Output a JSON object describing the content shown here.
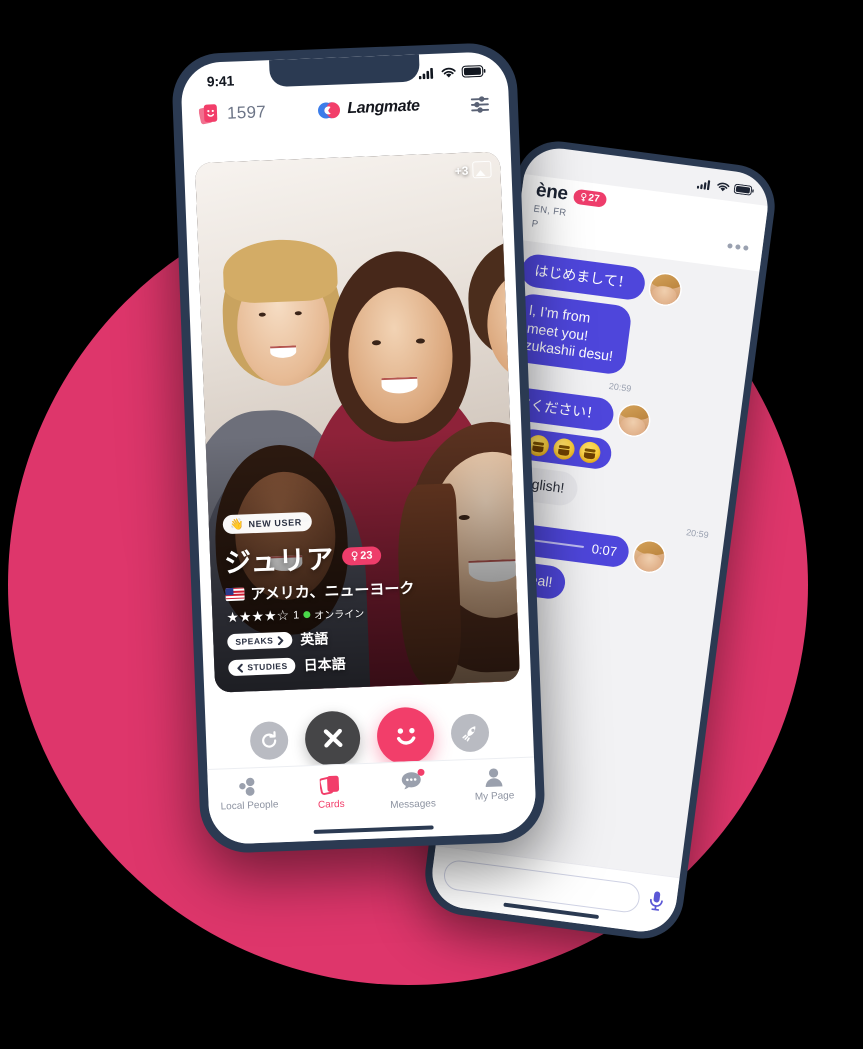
{
  "background": {
    "circle_color": "#DE366B",
    "page_color": "#000000"
  },
  "brand": {
    "name": "Langmate",
    "accent_pink": "#F23E6A",
    "accent_blue": "#3B7DEA",
    "chat_purple": "#4E46DB",
    "frame_navy": "#2B3A52"
  },
  "main_phone": {
    "status_bar": {
      "time": "9:41",
      "signal_icon": "signal-bars-icon",
      "wifi_icon": "wifi-icon",
      "battery_icon": "battery-icon"
    },
    "app_bar": {
      "card_stack_icon": "card-stack-icon",
      "card_count": "1597",
      "logo_icon": "langmate-logo-icon",
      "brand_label": "Langmate",
      "filter_icon": "sliders-filter-icon"
    },
    "card": {
      "photo_badge_count": "+3",
      "photo_badge_icon": "photo-gallery-icon",
      "new_user_emoji": "👋",
      "new_user_label": "NEW USER",
      "name": "ジュリア",
      "age": "23",
      "gender_icon": "female-symbol-icon",
      "flag_icon": "us-flag-icon",
      "location": "アメリカ、ニューヨーク",
      "stars": "★★★★☆",
      "rating_count": "1",
      "online_label": "オンライン",
      "speaks_label": "SPEAKS",
      "speaks_value": "英語",
      "studies_label": "STUDIES",
      "studies_value": "日本語"
    },
    "actions": [
      {
        "name": "rewind-button",
        "icon": "refresh-icon"
      },
      {
        "name": "pass-button",
        "icon": "close-x-icon"
      },
      {
        "name": "like-button",
        "icon": "smiley-face-icon"
      },
      {
        "name": "boost-button",
        "icon": "rocket-icon"
      }
    ],
    "tabs": [
      {
        "label": "Local People",
        "icon": "people-dots-icon",
        "active": false
      },
      {
        "label": "Cards",
        "icon": "cards-icon",
        "active": true
      },
      {
        "label": "Messages",
        "icon": "chat-bubble-icon",
        "active": false,
        "badge": true
      },
      {
        "label": "My Page",
        "icon": "person-icon",
        "active": false
      }
    ]
  },
  "chat_phone": {
    "status_bar": {
      "signal_icon": "signal-bars-icon",
      "wifi_icon": "wifi-icon",
      "battery_icon": "battery-icon"
    },
    "header": {
      "name": "ène",
      "age": "27",
      "gender_icon": "female-symbol-icon",
      "location_line1": "EN, FR",
      "location_line2": "P",
      "more_icon": "more-dots-icon"
    },
    "messages": [
      {
        "from": "them",
        "type": "text",
        "text": "はじめまして！",
        "avatar": true
      },
      {
        "from": "them",
        "type": "text",
        "text": "l, I’m from\n meet you!\nzukashii desu!",
        "avatar": false
      },
      {
        "from": "me",
        "type": "time",
        "text": "20:59"
      },
      {
        "from": "them",
        "type": "text",
        "text": "てください！",
        "avatar": true
      },
      {
        "from": "them",
        "type": "emoji",
        "emojis": [
          "😄",
          "😆",
          "😄"
        ]
      },
      {
        "from": "me",
        "type": "text",
        "text": "English!"
      },
      {
        "from": "me",
        "type": "time",
        "text": "20:59"
      },
      {
        "from": "them",
        "type": "voice",
        "duration": "0:07",
        "avatar": true
      },
      {
        "from": "them",
        "type": "text",
        "text": "Ok! Deal!"
      }
    ],
    "input_bar": {
      "placeholder": "",
      "mic_icon": "microphone-icon"
    }
  }
}
